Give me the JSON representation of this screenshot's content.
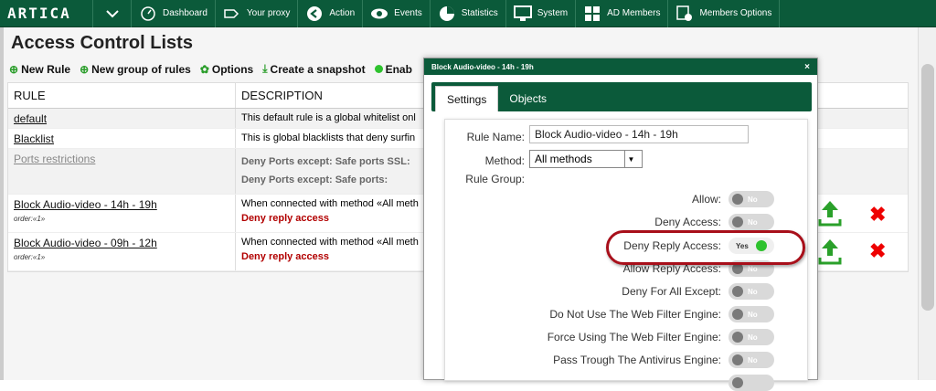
{
  "nav": {
    "logo": "ARTICA",
    "items": [
      {
        "label": "Dashboard",
        "icon": "dashboard-icon"
      },
      {
        "label": "Your proxy",
        "icon": "proxy-icon"
      },
      {
        "label": "Action",
        "icon": "back-arrow-icon"
      },
      {
        "label": "Events",
        "icon": "eye-icon"
      },
      {
        "label": "Statistics",
        "icon": "pie-chart-icon"
      },
      {
        "label": "System",
        "icon": "monitor-icon"
      },
      {
        "label": "AD Members",
        "icon": "windows-icon"
      },
      {
        "label": "Members Options",
        "icon": "members-gear-icon"
      }
    ]
  },
  "page": {
    "title": "Access Control Lists",
    "toolbar": {
      "new_rule": "New Rule",
      "new_group": "New group of rules",
      "options": "Options",
      "snapshot": "Create a snapshot",
      "enable": "Enab"
    },
    "columns": {
      "rule": "RULE",
      "description": "DESCRIPTION"
    },
    "rows": [
      {
        "rule": "default",
        "desc": "This default rule is a global whitelist onl"
      },
      {
        "rule": "Blacklist",
        "desc": "This is global blacklists that deny surfin"
      },
      {
        "rule": "Ports restrictions",
        "desc1": "Deny Ports except: Safe ports SSL:",
        "desc2": "Deny Ports except: Safe ports:"
      },
      {
        "rule": "Block Audio-video - 14h - 19h",
        "order": "order:«1»",
        "desc": "When connected with method «All meth",
        "deny": "Deny reply access"
      },
      {
        "rule": "Block Audio-video - 09h - 12h",
        "order": "order:«1»",
        "desc": "When connected with method «All meth",
        "deny": "Deny reply access"
      }
    ]
  },
  "modal": {
    "title": "Block Audio-video - 14h - 19h",
    "close": "×",
    "tabs": [
      "Settings",
      "Objects"
    ],
    "fields": {
      "rule_name_label": "Rule Name:",
      "rule_name_value": "Block Audio-video - 14h - 19h",
      "method_label": "Method:",
      "method_value": "All methods",
      "rule_group_label": "Rule Group:"
    },
    "toggles": [
      {
        "label": "Allow:",
        "state": "No"
      },
      {
        "label": "Deny Access:",
        "state": "No"
      },
      {
        "label": "Deny Reply Access:",
        "state": "Yes"
      },
      {
        "label": "Allow Reply Access:",
        "state": "No"
      },
      {
        "label": "Deny For All Except:",
        "state": "No"
      },
      {
        "label": "Do Not Use The Web Filter Engine:",
        "state": "No"
      },
      {
        "label": "Force Using The Web Filter Engine:",
        "state": "No"
      },
      {
        "label": "Pass Trough The Antivirus Engine:",
        "state": "No"
      }
    ]
  },
  "colors": {
    "brand": "#0b5a3a",
    "deny": "#b20000",
    "highlight": "#a80f1a",
    "toggle_on": "#2ec22e"
  }
}
